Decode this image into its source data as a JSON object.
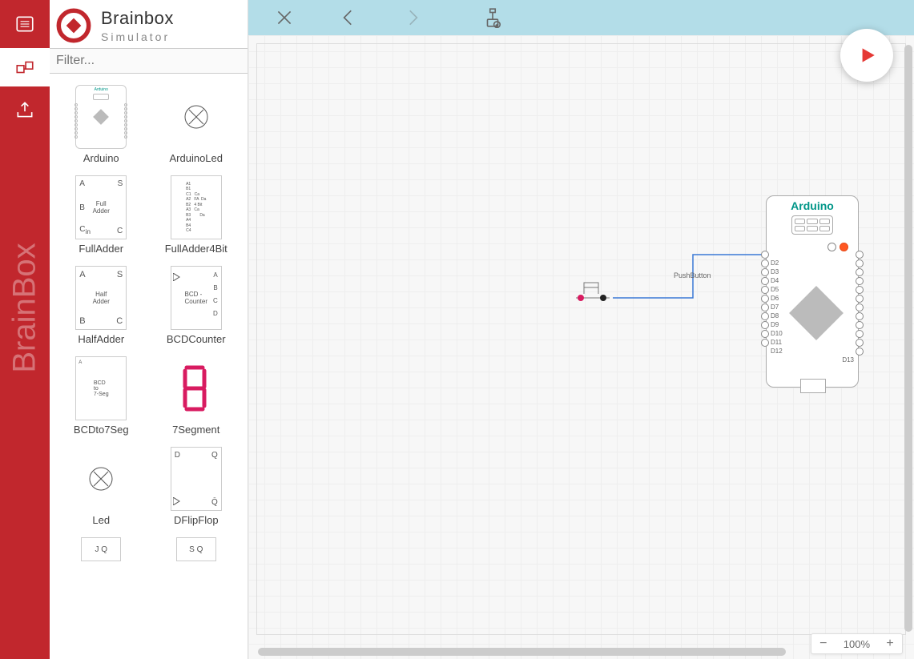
{
  "brand": {
    "title": "Brainbox",
    "subtitle": "Simulator",
    "watermark": "BrainBox"
  },
  "rail": {
    "items": [
      {
        "id": "list",
        "active": false
      },
      {
        "id": "design",
        "active": true
      },
      {
        "id": "export",
        "active": false
      }
    ]
  },
  "filter": {
    "placeholder": "Filter..."
  },
  "palette": [
    {
      "label": "Arduino",
      "thumb": "arduino"
    },
    {
      "label": "ArduinoLed",
      "thumb": "led"
    },
    {
      "label": "FullAdder",
      "thumb": "fulladder"
    },
    {
      "label": "FullAdder4Bit",
      "thumb": "fa4"
    },
    {
      "label": "HalfAdder",
      "thumb": "halfadder"
    },
    {
      "label": "BCDCounter",
      "thumb": "bcdcnt"
    },
    {
      "label": "BCDto7Seg",
      "thumb": "bcd7"
    },
    {
      "label": "7Segment",
      "thumb": "seg7"
    },
    {
      "label": "Led",
      "thumb": "led"
    },
    {
      "label": "DFlipFlop",
      "thumb": "dff"
    },
    {
      "label": "",
      "thumb": "jkff"
    },
    {
      "label": "",
      "thumb": "srff"
    }
  ],
  "toolbar": {
    "close": "close",
    "back": "back",
    "forward": "forward",
    "deploy": "deploy"
  },
  "canvas": {
    "pushbutton_label": "PushButton",
    "arduino": {
      "title": "Arduino",
      "pins_left": [
        "D2",
        "D3",
        "D4",
        "D5",
        "D6",
        "D7",
        "D8",
        "D9",
        "D10",
        "D11",
        "D12"
      ],
      "pins_right_count": 11,
      "d13_label": "D13",
      "led_on_index": 1
    }
  },
  "zoom": {
    "level": "100%"
  },
  "thumb_text": {
    "fulladder_a": "A",
    "fulladder_s": "S",
    "fulladder_b": "B",
    "fulladder_c": "C",
    "fulladder_cin": "C",
    "fulladder_cin2": "in",
    "fulladder_mid": "Full\nAdder",
    "halfadder_mid": "Half\nAdder",
    "bcdcnt_mid": "BCD -\nCounter",
    "bcdcnt_a": "A",
    "bcdcnt_b": "B",
    "bcdcnt_c": "C",
    "bcdcnt_d": "D",
    "fa4_lines": "A1\nB1\nC1   Ca\nA2   FA  Da\nB2   4 Bit\nA3   Ca\nB3        Da\nA4\nB4\nC4",
    "bcd7_mid": "BCD\nto\n7-Seg",
    "bcd7_a": "A",
    "dff_d": "D",
    "dff_q": "Q",
    "dff_qb": "Q̄",
    "jkff": "J   Q",
    "srff": "S   Q"
  }
}
